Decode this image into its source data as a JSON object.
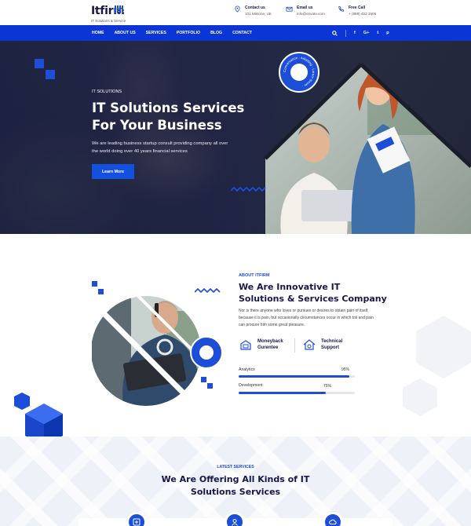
{
  "brand": {
    "logo_text": "Itfirm",
    "tagline": "IT Solutions & Service"
  },
  "contacts": [
    {
      "icon": "map-pin-icon",
      "title": "Contact us",
      "detail": "101 Mistone, UK"
    },
    {
      "icon": "mail-icon",
      "title": "Email us",
      "detail": "info@envato.com"
    },
    {
      "icon": "phone-icon",
      "title": "Free Call",
      "detail": "+ (888) 452 1505"
    }
  ],
  "nav": {
    "items": [
      "HOME",
      "ABOUT US",
      "SERVICES",
      "PORTFOLIO",
      "BLOG",
      "CONTACT"
    ],
    "social": [
      "f",
      "G+",
      "t",
      "p"
    ]
  },
  "hero": {
    "kicker": "IT SOLUTIONS",
    "title": "IT Solutions Services For Your Business",
    "description": "We are leading business startup consult providing company all over the world doing over 40 years financial services",
    "button": "Learn More",
    "badge_text": "Conversation · Adopting · Lorem Ipsum · "
  },
  "about": {
    "kicker": "ABOUT ITFIRM",
    "title": "We Are Innovative IT Solutions & Services Company",
    "description": "Nor is there anyone who loves or pursues or desires to obtain pain of itself, because it is pain, but occasionally circumstances occur in which toil and pain can procure him some great pleasure.",
    "features": [
      {
        "icon": "money-box-icon",
        "label": "Moneyback Gurentee"
      },
      {
        "icon": "support-house-icon",
        "label": "Technical Support"
      }
    ],
    "skills": [
      {
        "label": "Analytics",
        "value": 95,
        "display": "95%"
      },
      {
        "label": "Development",
        "value": 75,
        "display": "75%"
      }
    ]
  },
  "services": {
    "kicker": "LATEST SERVICES",
    "title": "We Are Offering All Kinds of IT Solutions Services",
    "icons": [
      "digital-service-icon",
      "user-service-icon",
      "cloud-service-icon"
    ]
  },
  "colors": {
    "primary": "#0c35d6",
    "accent": "#1d4ed8",
    "dark": "#16184a"
  }
}
